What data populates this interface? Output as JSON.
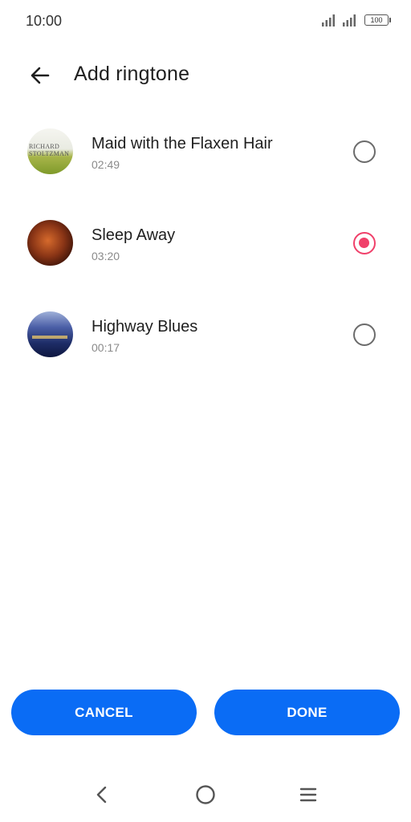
{
  "status_bar": {
    "time": "10:00",
    "battery_level": "100"
  },
  "header": {
    "title": "Add ringtone"
  },
  "ringtones": [
    {
      "title": "Maid with the Flaxen Hair",
      "duration": "02:49",
      "selected": false
    },
    {
      "title": "Sleep Away",
      "duration": "03:20",
      "selected": true
    },
    {
      "title": "Highway Blues",
      "duration": "00:17",
      "selected": false
    }
  ],
  "actions": {
    "cancel_label": "CANCEL",
    "done_label": "DONE"
  },
  "colors": {
    "primary": "#0a6cf5",
    "radio_selected": "#f0406a"
  },
  "icons": {
    "back": "arrow-left-icon",
    "nav_back": "chevron-left-icon",
    "nav_home": "circle-home-icon",
    "nav_menu": "hamburger-menu-icon"
  }
}
